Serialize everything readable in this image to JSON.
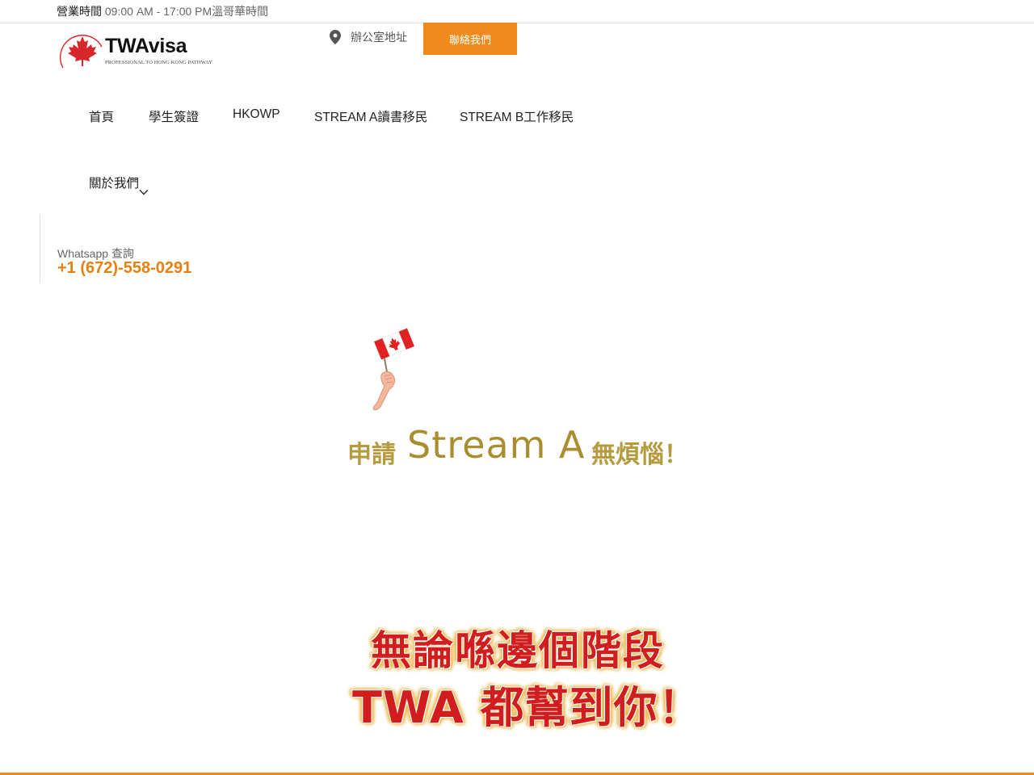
{
  "topbar": {
    "hours_label": "營業時間",
    "hours_value": " 09:00 AM - 17:00 PM溫哥華時間"
  },
  "logo": {
    "brand": "TWAvisa",
    "tagline": "PROFESSIONAL TO HONG KONG PATHWAY",
    "icon": "maple-leaf-icon"
  },
  "header": {
    "office_label": "辦公室地址",
    "office_icon": "location-pin-icon",
    "contact_button": "聯絡我們"
  },
  "nav": {
    "items": [
      {
        "label": "首頁"
      },
      {
        "label": "學生簽證"
      },
      {
        "label": "HKOWP"
      },
      {
        "label": "STREAM A讀書移民"
      },
      {
        "label": "STREAM B工作移民"
      },
      {
        "label": "關於我們",
        "has_dropdown": true
      }
    ]
  },
  "whatsapp": {
    "label": "Whatsapp 查詢",
    "phone": "+1 (672)-558-0291"
  },
  "hero": {
    "prefix": "申請",
    "highlight": "Stream A",
    "suffix": "無煩惱！",
    "illustration": "hand-holding-canada-flag"
  },
  "promo": {
    "line1": "無論喺邊個階段",
    "line2": "TWA 都幫到你！"
  },
  "colors": {
    "accent": "#f08a1c",
    "phone": "#e57f10",
    "gold": "#b59a3e",
    "promo_red": "#d11d1d",
    "maple_red": "#d9262b"
  }
}
